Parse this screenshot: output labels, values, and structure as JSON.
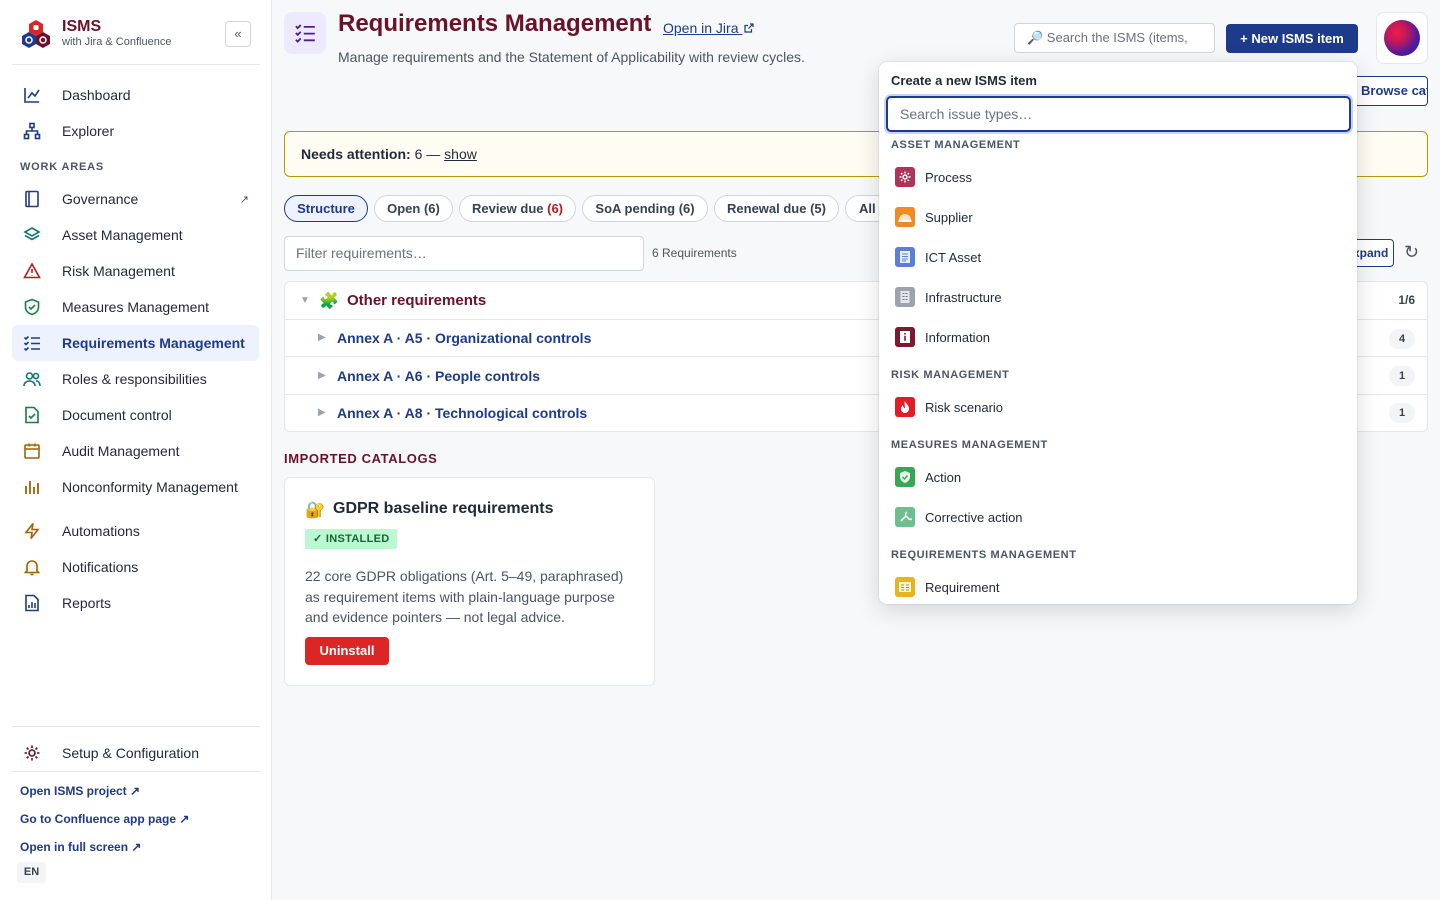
{
  "brand": {
    "name": "ISMS",
    "subtitle": "with Jira & Confluence",
    "collapse": "«"
  },
  "sidebar": {
    "items": [
      {
        "label": "Dashboard"
      },
      {
        "label": "Explorer"
      }
    ],
    "section_label": "WORK AREAS",
    "work_areas": [
      {
        "label": "Governance",
        "ext": "↗"
      },
      {
        "label": "Asset Management"
      },
      {
        "label": "Risk Management"
      },
      {
        "label": "Measures Management"
      },
      {
        "label": "Requirements Management"
      },
      {
        "label": "Roles & responsibilities"
      },
      {
        "label": "Document control"
      },
      {
        "label": "Audit Management"
      },
      {
        "label": "Nonconformity Management"
      }
    ],
    "tools": [
      {
        "label": "Automations"
      },
      {
        "label": "Notifications"
      },
      {
        "label": "Reports"
      }
    ],
    "setup": "Setup & Configuration",
    "links": [
      "Open ISMS project ↗",
      "Go to Confluence app page ↗",
      "Open in full screen ↗"
    ],
    "lang": "EN"
  },
  "header": {
    "title": "Requirements Management",
    "jira_link": "Open in Jira",
    "description": "Manage requirements and the Statement of Applicability with review cycles.",
    "search_placeholder": "🔎 Search the ISMS (items,",
    "new_button": "+ New ISMS item",
    "catalogs_button": "Browse catalogs"
  },
  "attention": {
    "label": "Needs attention:",
    "value": "6 —",
    "link": "show"
  },
  "tabs": [
    {
      "label": "Structure",
      "count": ""
    },
    {
      "label": "Open (6)",
      "count": ""
    },
    {
      "label": "Review due",
      "count": "(6)"
    },
    {
      "label": "SoA pending (6)",
      "count": ""
    },
    {
      "label": "Renewal due (5)",
      "count": ""
    },
    {
      "label": "All",
      "count": ""
    }
  ],
  "filter": {
    "placeholder": "Filter requirements…",
    "count": "6 Requirements",
    "expand_all": "Expand all"
  },
  "tree": {
    "group": {
      "label": "Other requirements",
      "ratio": "1/6"
    },
    "rows": [
      {
        "label": "Annex A · A5 · Organizational controls",
        "count": "4"
      },
      {
        "label": "Annex A · A6 · People controls",
        "count": "1"
      },
      {
        "label": "Annex A · A8 · Technological controls",
        "count": "1"
      }
    ]
  },
  "catalogs": {
    "heading": "IMPORTED CATALOGS",
    "card": {
      "icon": "🔐",
      "title": "GDPR baseline requirements",
      "badge": "✓ INSTALLED",
      "description": "22 core GDPR obligations (Art. 5–49, paraphrased) as requirement items with plain-language purpose and evidence pointers — not legal advice.",
      "action": "Uninstall"
    }
  },
  "dropdown": {
    "title": "Create a new ISMS item",
    "search_placeholder": "Search issue types…",
    "groups": [
      {
        "label": "ASSET MANAGEMENT",
        "items": [
          {
            "label": "Process",
            "icon": "process-icon",
            "color": "#b0345a"
          },
          {
            "label": "Supplier",
            "icon": "supplier-icon",
            "color": "#f08a24"
          },
          {
            "label": "ICT Asset",
            "icon": "ict-asset-icon",
            "color": "#5b7fd6"
          },
          {
            "label": "Infrastructure",
            "icon": "infrastructure-icon",
            "color": "#9ca3af"
          },
          {
            "label": "Information",
            "icon": "information-icon",
            "color": "#7a1a2e"
          }
        ]
      },
      {
        "label": "RISK MANAGEMENT",
        "items": [
          {
            "label": "Risk scenario",
            "icon": "risk-scenario-icon",
            "color": "#e11d2a"
          }
        ]
      },
      {
        "label": "MEASURES MANAGEMENT",
        "items": [
          {
            "label": "Action",
            "icon": "action-icon",
            "color": "#34a853"
          },
          {
            "label": "Corrective action",
            "icon": "corrective-action-icon",
            "color": "#6cc08b"
          }
        ]
      },
      {
        "label": "REQUIREMENTS MANAGEMENT",
        "items": [
          {
            "label": "Requirement",
            "icon": "requirement-icon",
            "color": "#e9b31e"
          }
        ]
      }
    ]
  },
  "colors": {
    "brand": "#6b1228",
    "accent": "#1e3a8a",
    "danger": "#dc2626",
    "warning_border": "#b59b00"
  }
}
